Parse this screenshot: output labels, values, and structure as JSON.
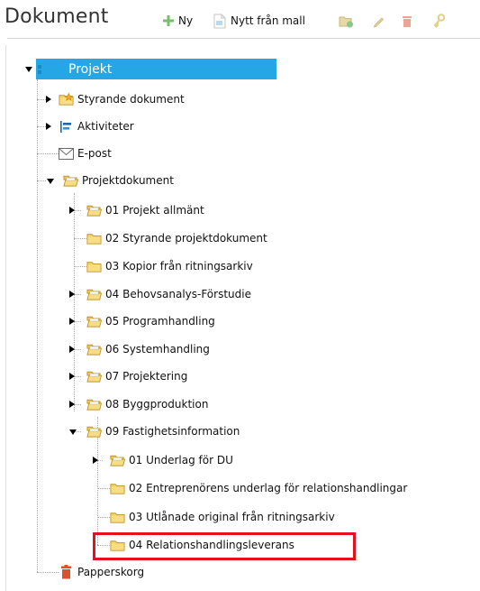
{
  "toolbar": {
    "title": "Dokument",
    "new_label": "Ny",
    "from_template_label": "Nytt från mall",
    "icons": [
      "plus-icon",
      "template-icon",
      "copy-folder-icon",
      "pencil-icon",
      "trash-icon",
      "key-icon"
    ]
  },
  "tree": {
    "root": {
      "label": "Projekt",
      "expanded": true,
      "selected": true
    },
    "items": [
      {
        "label": "Styrande dokument",
        "icon": "folder-star-icon",
        "expanded": false
      },
      {
        "label": "Aktiviteter",
        "icon": "gantt-icon",
        "expanded": false
      },
      {
        "label": "E-post",
        "icon": "envelope-icon"
      },
      {
        "label": "Projektdokument",
        "icon": "folder-open-icon",
        "expanded": true,
        "children": [
          {
            "label": "01 Projekt allmänt",
            "expanded": false
          },
          {
            "label": "02 Styrande projektdokument"
          },
          {
            "label": "03 Kopior från ritningsarkiv"
          },
          {
            "label": "04 Behovsanalys-Förstudie",
            "expanded": false
          },
          {
            "label": "05 Programhandling",
            "expanded": false
          },
          {
            "label": "06 Systemhandling",
            "expanded": false
          },
          {
            "label": "07 Projektering",
            "expanded": false
          },
          {
            "label": "08 Byggproduktion",
            "expanded": false
          },
          {
            "label": "09 Fastighetsinformation",
            "expanded": true,
            "children": [
              {
                "label": "01 Underlag för DU",
                "expanded": false
              },
              {
                "label": "02 Entreprenörens underlag för relationshandlingar"
              },
              {
                "label": "03 Utlånade original från ritningsarkiv"
              },
              {
                "label": "04 Relationshandlingsleverans",
                "highlighted": true
              }
            ]
          }
        ]
      },
      {
        "label": "Papperskorg",
        "icon": "trash-icon"
      }
    ]
  },
  "colors": {
    "selection": "#25a7e6",
    "highlight_border": "#e2131f",
    "folder": "#f2c85a",
    "toolbar_plus": "#74c06a",
    "trash": "#d8532c"
  }
}
